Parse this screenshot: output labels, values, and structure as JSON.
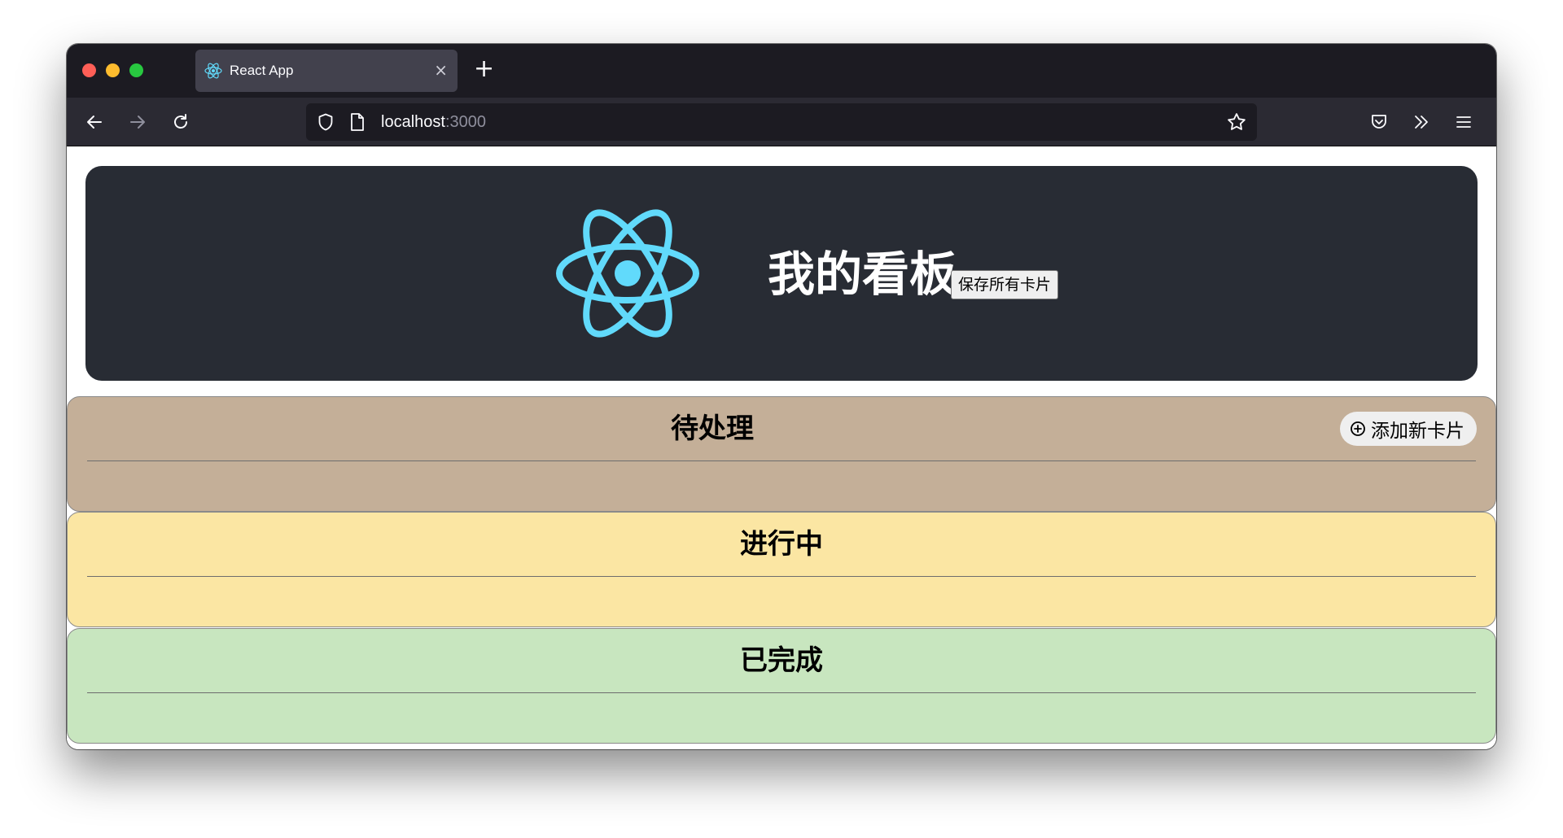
{
  "browser": {
    "tab_title": "React App",
    "tab_close": "×",
    "new_tab": "+",
    "url_host": "localhost",
    "url_port": ":3000"
  },
  "header": {
    "title": "我的看板",
    "save_all_label": "保存所有卡片",
    "logo_color": "#61dafb",
    "background": "#282c34"
  },
  "columns": [
    {
      "title": "待处理",
      "color": "#c4af98",
      "add_label": "添加新卡片"
    },
    {
      "title": "进行中",
      "color": "#fbe6a3"
    },
    {
      "title": "已完成",
      "color": "#c8e6bf"
    }
  ]
}
